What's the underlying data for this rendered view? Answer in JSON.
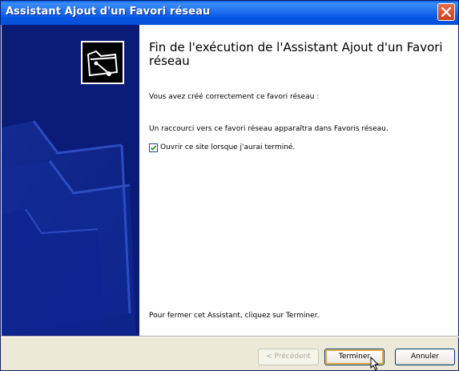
{
  "window": {
    "title": "Assistant Ajout d'un Favori réseau"
  },
  "content": {
    "heading": "Fin de l'exécution de l'Assistant Ajout d'un Favori réseau",
    "created_text": "Vous avez créé correctement ce favori réseau :",
    "shortcut_text": "Un raccourci vers ce favori réseau apparaîtra dans Favoris réseau.",
    "checkbox_label": "Ouvrir ce site lorsque j'aurai terminé.",
    "checkbox_checked": true,
    "footer_text": "Pour fermer cet Assistant, cliquez sur Terminer."
  },
  "buttons": {
    "back": "< Précédent",
    "finish": "Terminer",
    "cancel": "Annuler"
  },
  "colors": {
    "sidebar": "#0a1b78",
    "titlebar": "#0755e6",
    "close": "#d6522b"
  }
}
